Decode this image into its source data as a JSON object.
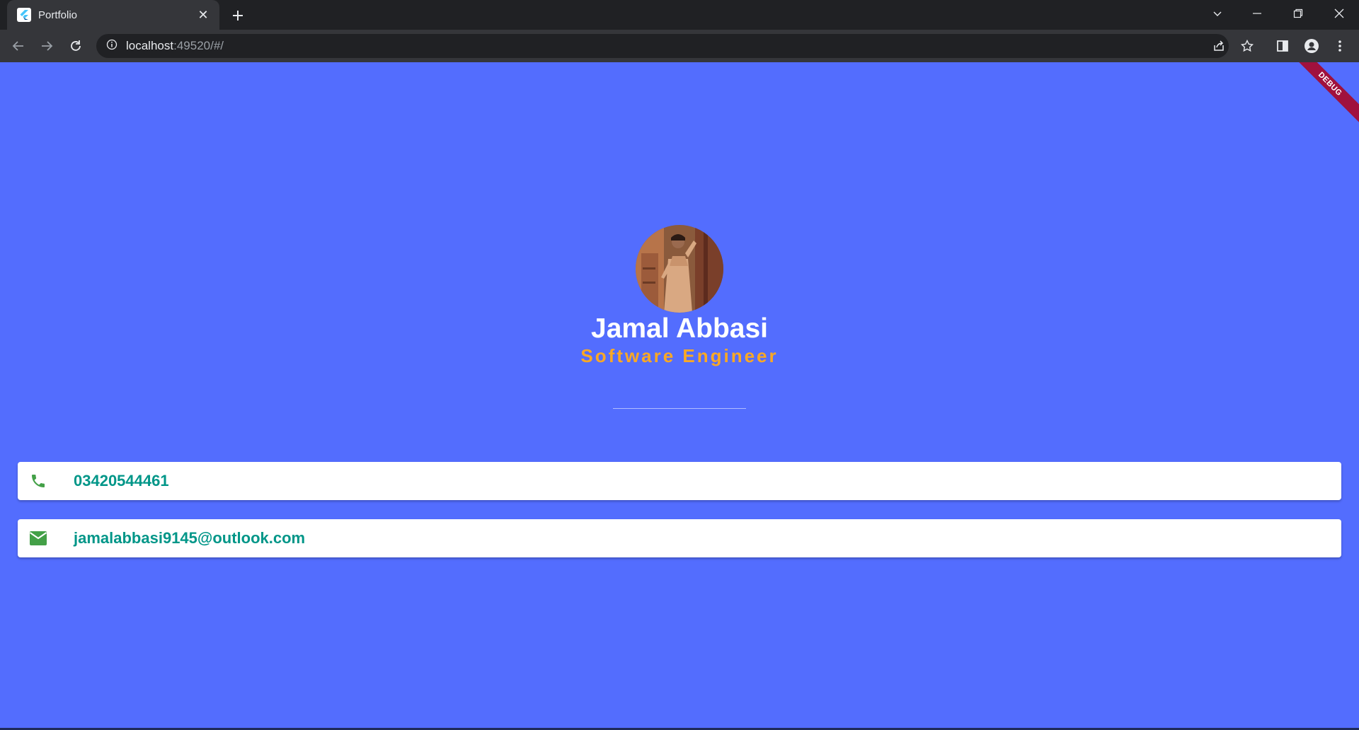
{
  "browser": {
    "tab_title": "Portfolio",
    "url_host": "localhost",
    "url_rest": ":49520/#/"
  },
  "page": {
    "debug_label": "DEBUG",
    "name": "Jamal Abbasi",
    "role": "Software Engineer",
    "contacts": {
      "phone": "03420544461",
      "email": "jamalabbasi9145@outlook.com"
    }
  },
  "colors": {
    "background": "#536dfe",
    "role_text": "#f9a825",
    "contact_text": "#009688",
    "contact_icon": "#43a047"
  },
  "icons": {
    "phone": "phone-icon",
    "email": "email-icon"
  }
}
